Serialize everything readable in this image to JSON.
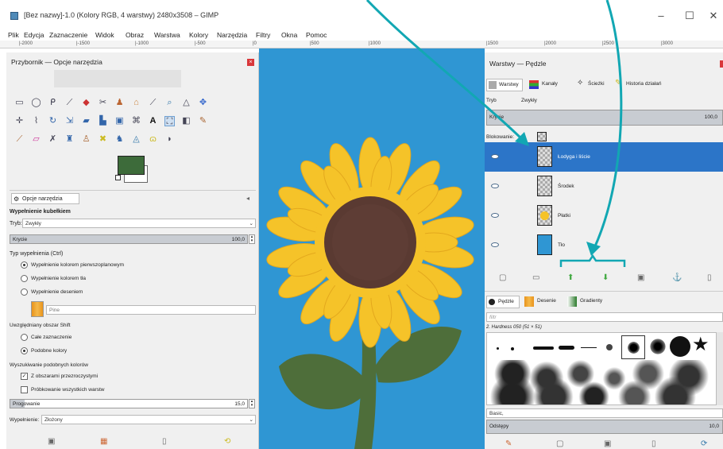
{
  "window": {
    "title": "[Bez nazwy]-1.0 (Kolory RGB, 4 warstwy) 2480x3508 – GIMP",
    "minimize": "–",
    "maximize": "☐",
    "close": "✕"
  },
  "menu": [
    "Plik",
    "Edycja",
    "Zaznaczenie",
    "Widok",
    "Obraz",
    "Warstwa",
    "Kolory",
    "Narzędzia",
    "Filtry",
    "Okna",
    "Pomoc"
  ],
  "ruler": [
    "|-2000",
    "|-1500",
    "|-1000",
    "|-500",
    "|0",
    "|500",
    "|1000",
    "|1500",
    "|2000",
    "|2500",
    "|3000"
  ],
  "toolbox": {
    "title": "Przybornik — Opcje narzędzia",
    "close": "×"
  },
  "tool_options": {
    "tab": "Opcje narzędzia",
    "heading": "Wypełnienie kubełkiem",
    "mode_label": "Tryb:",
    "mode_value": "Zwykły",
    "opacity_label": "Krycie",
    "opacity_value": "100,0",
    "fill_type_label": "Typ wypełnienia  (Ctrl)",
    "fill_options": [
      "Wypełnienie kolorem pierwszoplanowym",
      "Wypełnienie kolorem tła",
      "Wypełnienie deseniem"
    ],
    "pattern_name": "Pine",
    "area_label": "Uwzględniany obszar  Shift",
    "area_options": [
      "Całe zaznaczenie",
      "Podobne kolory"
    ],
    "similar_label": "Wyszukiwanie podobnych kolorów",
    "check1": "Z obszarami przezroczystymi",
    "check2": "Próbkowanie wszystkich warstw",
    "threshold_label": "Progowanie",
    "threshold_value": "15,0",
    "fill_by_label": "Wypełnienie:",
    "fill_by_value": "Złożony"
  },
  "colors": {
    "foreground": "#3d6b3a",
    "background": "#ffffff",
    "canvas": "#2f96d3",
    "petal": "#f5c329",
    "center": "#5a3a32",
    "stem": "#4e6e3a",
    "accent_arrow": "#12a7b3",
    "selected_layer": "#2c75c8"
  },
  "layers_panel": {
    "title": "Warstwy — Pędzle",
    "tabs": [
      "Warstwy",
      "Kanały",
      "Ścieżki",
      "Historia działań"
    ],
    "mode_label": "Tryb",
    "mode_value": "Zwykły",
    "opacity_label": "Krycie",
    "opacity_value": "100,0",
    "lock_label": "Blokowanie:",
    "layers": [
      {
        "name": "Łodyga i liście",
        "selected": true
      },
      {
        "name": "Środek",
        "selected": false
      },
      {
        "name": "Płatki",
        "selected": false
      },
      {
        "name": "Tło",
        "selected": false
      }
    ]
  },
  "brushes_panel": {
    "tabs": [
      "Pędzle",
      "Desenie",
      "Gradienty"
    ],
    "filter_placeholder": "filtr",
    "brush_name": "2. Hardness 050 (51 × 51)",
    "preset": "Basic,",
    "spacing_label": "Odstępy",
    "spacing_value": "10,0"
  }
}
